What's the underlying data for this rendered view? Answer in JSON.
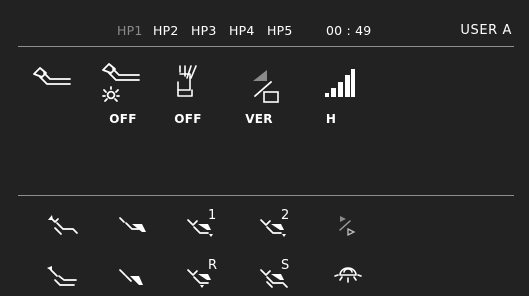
{
  "header": {
    "handpieces": [
      {
        "label": "HP1",
        "active": false
      },
      {
        "label": "HP2",
        "active": true
      },
      {
        "label": "HP3",
        "active": true
      },
      {
        "label": "HP4",
        "active": true
      },
      {
        "label": "HP5",
        "active": true
      }
    ],
    "timer": "00 : 49",
    "user": "USER A"
  },
  "functions": [
    {
      "name": "chair-recline",
      "icon": "chair-recline-icon",
      "label": ""
    },
    {
      "name": "chair-light",
      "icon": "chair-light-icon",
      "label": "OFF"
    },
    {
      "name": "spittoon-rinse",
      "icon": "cup-fill-icon",
      "label": "OFF"
    },
    {
      "name": "ver",
      "icon": "slope-rect-icon",
      "label": "VER"
    },
    {
      "name": "power-level",
      "icon": "signal-bars-icon",
      "label": "H"
    }
  ],
  "shortcuts_row1": [
    {
      "name": "chair-up",
      "icon": "chair-up-icon",
      "sup": ""
    },
    {
      "name": "chair-down",
      "icon": "chair-down-icon",
      "sup": ""
    },
    {
      "name": "memory-1",
      "icon": "chair-memory-icon",
      "sup": "1"
    },
    {
      "name": "memory-2",
      "icon": "chair-memory-icon",
      "sup": "2"
    },
    {
      "name": "play",
      "icon": "play-slope-icon",
      "sup": ""
    }
  ],
  "shortcuts_row2": [
    {
      "name": "back-up",
      "icon": "back-up-icon",
      "sup": ""
    },
    {
      "name": "back-down",
      "icon": "back-down-icon",
      "sup": ""
    },
    {
      "name": "return-position",
      "icon": "chair-memory-icon",
      "sup": "R"
    },
    {
      "name": "spit-position",
      "icon": "chair-memory-icon",
      "sup": "S"
    },
    {
      "name": "operating-light",
      "icon": "operating-light-icon",
      "sup": ""
    }
  ],
  "colors": {
    "panel": "#222222",
    "text": "#ffffff",
    "dim": "#8a8a8a",
    "divider": "#8f8f8f"
  }
}
